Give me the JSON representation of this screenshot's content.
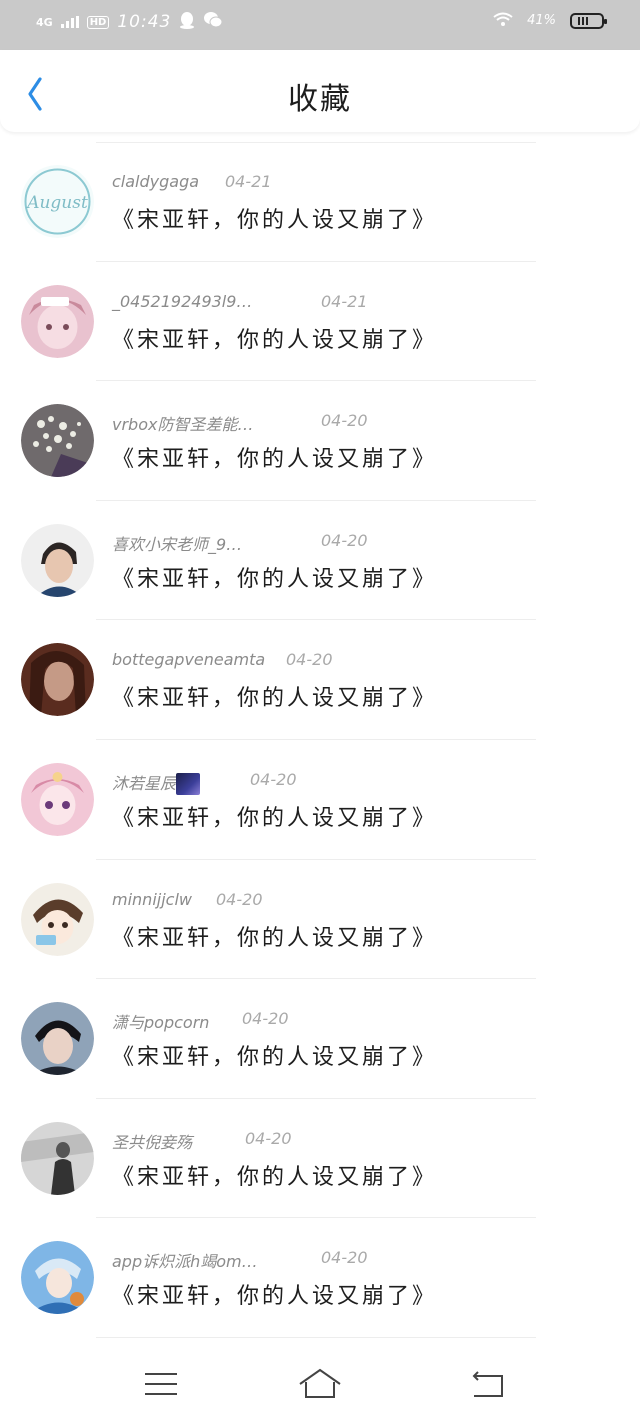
{
  "status_bar": {
    "network": "4G",
    "hd": "HD",
    "time": "10:43",
    "battery_percent": "41%"
  },
  "header": {
    "title": "收藏",
    "back_icon": "chevron-left-icon",
    "accent_color": "#2d8de5"
  },
  "items": [
    {
      "username": "claldygaga",
      "date": "04-21",
      "message": "《宋亚轩，你的人设又崩了》",
      "avatar_icon": "august-logo-avatar"
    },
    {
      "username": "_0452192493l9…",
      "date": "04-21",
      "message": "《宋亚轩，你的人设又崩了》",
      "avatar_icon": "anime-girl-avatar"
    },
    {
      "username": "vrbox防智圣差能…",
      "date": "04-20",
      "message": "《宋亚轩，你的人设又崩了》",
      "avatar_icon": "flowers-avatar"
    },
    {
      "username": "喜欢小宋老师_9…",
      "date": "04-20",
      "message": "《宋亚轩，你的人设又崩了》",
      "avatar_icon": "boy-photo-avatar"
    },
    {
      "username": "bottegapveneamta",
      "date": "04-20",
      "message": "《宋亚轩，你的人设又崩了》",
      "avatar_icon": "woman-photo-avatar"
    },
    {
      "username": "沐若星辰",
      "date": "04-20",
      "message": "《宋亚轩，你的人设又崩了》",
      "avatar_icon": "anime-pink-avatar"
    },
    {
      "username": "minnijjclw",
      "date": "04-20",
      "message": "《宋亚轩，你的人设又崩了》",
      "avatar_icon": "anime-boy-avatar"
    },
    {
      "username": "潇与popcorn",
      "date": "04-20",
      "message": "《宋亚轩，你的人设又崩了》",
      "avatar_icon": "young-man-avatar"
    },
    {
      "username": "圣共倪妾殇",
      "date": "04-20",
      "message": "《宋亚轩，你的人设又崩了》",
      "avatar_icon": "bw-photo-avatar"
    },
    {
      "username": "app诉炽派h竭om…",
      "date": "04-20",
      "message": "《宋亚轩，你的人设又崩了》",
      "avatar_icon": "anime-blue-avatar"
    }
  ],
  "nav_bar": {
    "menu_icon": "menu-icon",
    "home_icon": "home-icon",
    "back_icon": "back-icon"
  }
}
